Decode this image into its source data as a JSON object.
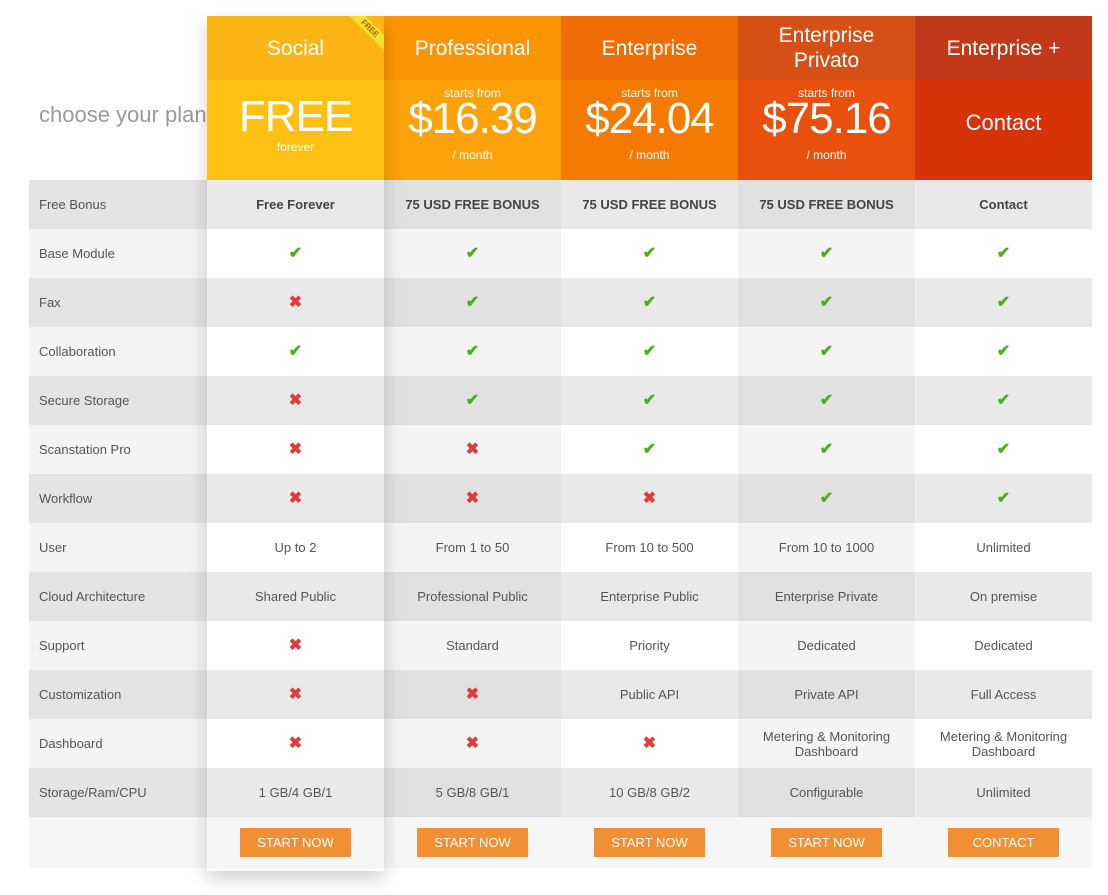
{
  "heading": "choose your plan",
  "plans": [
    {
      "name": "Social",
      "starts": "",
      "price": "FREE",
      "per": "forever",
      "type": "free",
      "ribbon": "FREE",
      "name_bg": "#fbb615",
      "price_bg": "#fdc114",
      "cta": "START NOW"
    },
    {
      "name": "Professional",
      "starts": "starts from",
      "price": "$16.39",
      "per": "/ month",
      "type": "price",
      "name_bg": "#fb9506",
      "price_bg": "#fda20a",
      "cta": "START NOW"
    },
    {
      "name": "Enterprise",
      "starts": "starts from",
      "price": "$24.04",
      "per": "/ month",
      "type": "price",
      "name_bg": "#f06c04",
      "price_bg": "#f47a04",
      "cta": "START NOW"
    },
    {
      "name": "Enterprise Privato",
      "starts": "starts from",
      "price": "$75.16",
      "per": "/ month",
      "type": "price",
      "name_bg": "#d64f14",
      "price_bg": "#e8500e",
      "cta": "START NOW"
    },
    {
      "name": "Enterprise +",
      "starts": "",
      "price": "Contact",
      "per": "",
      "type": "contact",
      "name_bg": "#c2391a",
      "price_bg": "#d7320a",
      "cta": "CONTACT"
    }
  ],
  "features": [
    {
      "label": "Free Bonus",
      "bold": true,
      "values": [
        "Free Forever",
        "75 USD FREE BONUS",
        "75 USD FREE BONUS",
        "75 USD FREE BONUS",
        "Contact"
      ]
    },
    {
      "label": "Base Module",
      "values": [
        "check",
        "check",
        "check",
        "check",
        "check"
      ]
    },
    {
      "label": "Fax",
      "values": [
        "cross",
        "check",
        "check",
        "check",
        "check"
      ]
    },
    {
      "label": "Collaboration",
      "values": [
        "check",
        "check",
        "check",
        "check",
        "check"
      ]
    },
    {
      "label": "Secure Storage",
      "values": [
        "cross",
        "check",
        "check",
        "check",
        "check"
      ]
    },
    {
      "label": "Scanstation Pro",
      "values": [
        "cross",
        "cross",
        "check",
        "check",
        "check"
      ]
    },
    {
      "label": "Workflow",
      "values": [
        "cross",
        "cross",
        "cross",
        "check",
        "check"
      ]
    },
    {
      "label": "User",
      "values": [
        "Up to 2",
        "From 1 to 50",
        "From 10 to 500",
        "From 10 to 1000",
        "Unlimited"
      ]
    },
    {
      "label": "Cloud Architecture",
      "values": [
        "Shared Public",
        "Professional Public",
        "Enterprise Public",
        "Enterprise Private",
        "On premise"
      ]
    },
    {
      "label": "Support",
      "values": [
        "cross",
        "Standard",
        "Priority",
        "Dedicated",
        "Dedicated"
      ]
    },
    {
      "label": "Customization",
      "values": [
        "cross",
        "cross",
        "Public API",
        "Private API",
        "Full Access"
      ]
    },
    {
      "label": "Dashboard",
      "values": [
        "cross",
        "cross",
        "cross",
        "Metering & Monitoring Dashboard",
        "Metering & Monitoring Dashboard"
      ]
    },
    {
      "label": "Storage/Ram/CPU",
      "values": [
        "1 GB/4 GB/1",
        "5 GB/8 GB/1",
        "10 GB/8 GB/2",
        "Configurable",
        "Unlimited"
      ]
    }
  ],
  "icons": {
    "check": "✔",
    "cross": "✖"
  }
}
